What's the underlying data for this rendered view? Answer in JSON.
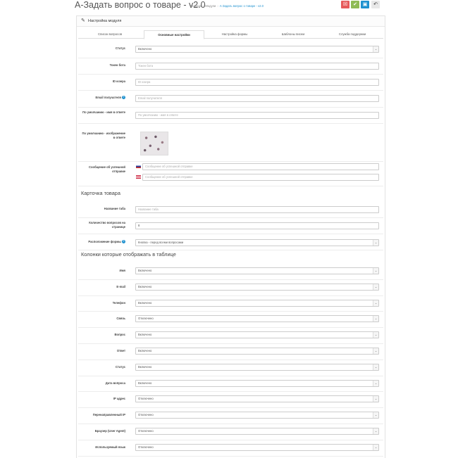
{
  "header": {
    "title": "А-Задать вопрос о товаре - v2.0",
    "breadcrumbs": [
      "Главная",
      "Модули",
      "А-Задать вопрос о товаре - v2.0"
    ],
    "buttons": [
      {
        "name": "cancel-red-button",
        "icon": "☒",
        "color": "#e65a5a"
      },
      {
        "name": "save-button",
        "icon": "✔",
        "color": "#8fbb55"
      },
      {
        "name": "save-stay-button",
        "icon": "▣",
        "color": "#1e91cf"
      },
      {
        "name": "back-button",
        "icon": "↶",
        "color": "#e8e8e8"
      }
    ]
  },
  "panel": {
    "title": "Настройка модуля"
  },
  "tabs": [
    "Список вопросов",
    "Основные настройки",
    "Настройка формы",
    "Шаблоны писем",
    "Служба поддержки"
  ],
  "fields": [
    {
      "label": "Статус",
      "value": "Включено",
      "type": "select"
    },
    {
      "label": "Токен бота",
      "placeholder": "Токен бота",
      "type": "input"
    },
    {
      "label": "ID юзера",
      "placeholder": "ID юзера",
      "type": "input"
    },
    {
      "label": "Email получателя",
      "placeholder": "Email получателя",
      "type": "input",
      "help": true
    },
    {
      "label": "По умолчанию - имя в ответе",
      "placeholder": "По умолчанию - имя в ответе",
      "type": "input"
    },
    {
      "label": "По умолчанию - изображение в ответе",
      "type": "image"
    },
    {
      "label": "Сообщение об успешной отправке",
      "placeholders": [
        "Сообщение об успешной отправке",
        "Сообщение об успешной отправке"
      ],
      "type": "multilang"
    }
  ],
  "section_product": {
    "title": "Карточка товара",
    "fields": [
      {
        "label": "Название таба",
        "placeholder": "Название таба",
        "type": "input"
      },
      {
        "label": "Количество вопросов на странице",
        "value": "8",
        "type": "input"
      },
      {
        "label": "Расположение формы",
        "value": "Кнопка - перед всеми вопросами",
        "type": "select",
        "help": true
      }
    ]
  },
  "section_columns": {
    "title": "Колонки которые отображать в таблице",
    "fields": [
      {
        "label": "Имя",
        "value": "Включено"
      },
      {
        "label": "E-mail",
        "value": "Включено"
      },
      {
        "label": "Телефон",
        "value": "Включено"
      },
      {
        "label": "Связь",
        "value": "Отключено"
      },
      {
        "label": "Вопрос",
        "value": "Включено"
      },
      {
        "label": "Ответ",
        "value": "Включено"
      },
      {
        "label": "Статус",
        "value": "Включено"
      },
      {
        "label": "Дата вопроса",
        "value": "Включено"
      },
      {
        "label": "IP адрес",
        "value": "Отключено"
      },
      {
        "label": "Перенаправленный IP",
        "value": "Отключено"
      },
      {
        "label": "Браузер (User Agent)",
        "value": "Отключено"
      },
      {
        "label": "Используемый язык",
        "value": "Отключено"
      }
    ]
  }
}
